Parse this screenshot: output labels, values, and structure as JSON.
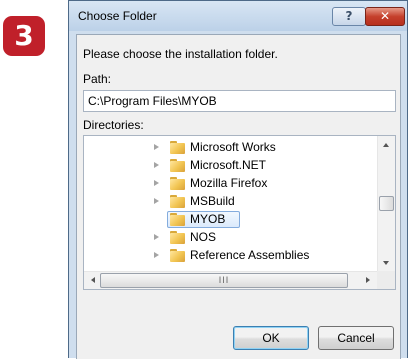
{
  "step_badge": "3",
  "dialog": {
    "title": "Choose Folder",
    "help_label": "?",
    "close_label": "✕",
    "instruction": "Please choose the installation folder.",
    "path_label": "Path:",
    "path_value": "C:\\Program Files\\MYOB",
    "directories_label": "Directories:",
    "directories": [
      {
        "label": "Microsoft Works",
        "expandable": true,
        "selected": false
      },
      {
        "label": "Microsoft.NET",
        "expandable": true,
        "selected": false
      },
      {
        "label": "Mozilla Firefox",
        "expandable": true,
        "selected": false
      },
      {
        "label": "MSBuild",
        "expandable": true,
        "selected": false
      },
      {
        "label": "MYOB",
        "expandable": false,
        "selected": true
      },
      {
        "label": "NOS",
        "expandable": true,
        "selected": false
      },
      {
        "label": "Reference Assemblies",
        "expandable": true,
        "selected": false
      }
    ],
    "hscroll_grip": "III",
    "ok_label": "OK",
    "cancel_label": "Cancel"
  },
  "colors": {
    "badge": "#c0202a",
    "window_frame": "#cfdeee",
    "close_button": "#c5402c"
  }
}
